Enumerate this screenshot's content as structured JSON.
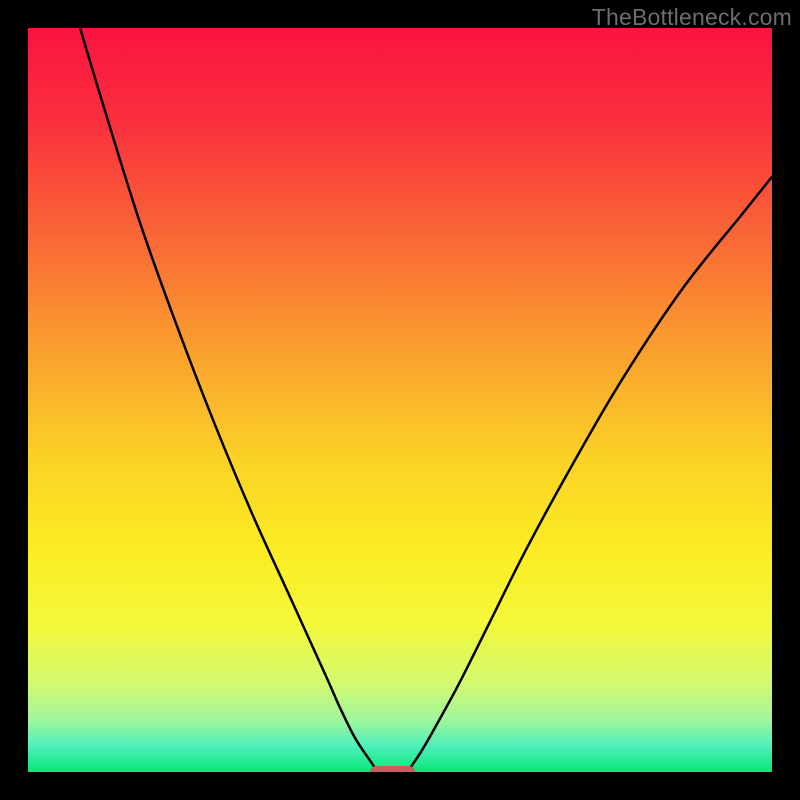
{
  "watermark": "TheBottleneck.com",
  "chart_data": {
    "type": "line",
    "title": "",
    "xlabel": "",
    "ylabel": "",
    "xlim": [
      0,
      100
    ],
    "ylim": [
      0,
      100
    ],
    "grid": false,
    "legend": false,
    "series": [
      {
        "name": "left-curve",
        "x": [
          7,
          10,
          15,
          20,
          25,
          30,
          35,
          40,
          42,
          44,
          46,
          47
        ],
        "values": [
          100,
          90,
          74,
          60,
          47,
          35,
          24,
          13,
          8.5,
          4.5,
          1.5,
          0
        ]
      },
      {
        "name": "right-curve",
        "x": [
          51,
          53,
          55,
          58,
          62,
          67,
          73,
          80,
          88,
          96,
          100
        ],
        "values": [
          0,
          3,
          6.5,
          12,
          20,
          30,
          41,
          53,
          65,
          75,
          80
        ]
      }
    ],
    "marker": {
      "name": "bottom-marker",
      "x": 49,
      "y": 0,
      "width": 6,
      "height": 1.6,
      "color": "#cb5d5d"
    },
    "background_gradient": {
      "stops": [
        {
          "offset": 0.0,
          "color": "#fa1440"
        },
        {
          "offset": 0.12,
          "color": "#fa2e3e"
        },
        {
          "offset": 0.28,
          "color": "#f96736"
        },
        {
          "offset": 0.44,
          "color": "#faa22e"
        },
        {
          "offset": 0.58,
          "color": "#fbd226"
        },
        {
          "offset": 0.7,
          "color": "#fbec23"
        },
        {
          "offset": 0.8,
          "color": "#f4f83a"
        },
        {
          "offset": 0.88,
          "color": "#d4f96f"
        },
        {
          "offset": 0.93,
          "color": "#a0f69d"
        },
        {
          "offset": 0.965,
          "color": "#4ef0bb"
        },
        {
          "offset": 1.0,
          "color": "#08e777"
        }
      ]
    }
  }
}
